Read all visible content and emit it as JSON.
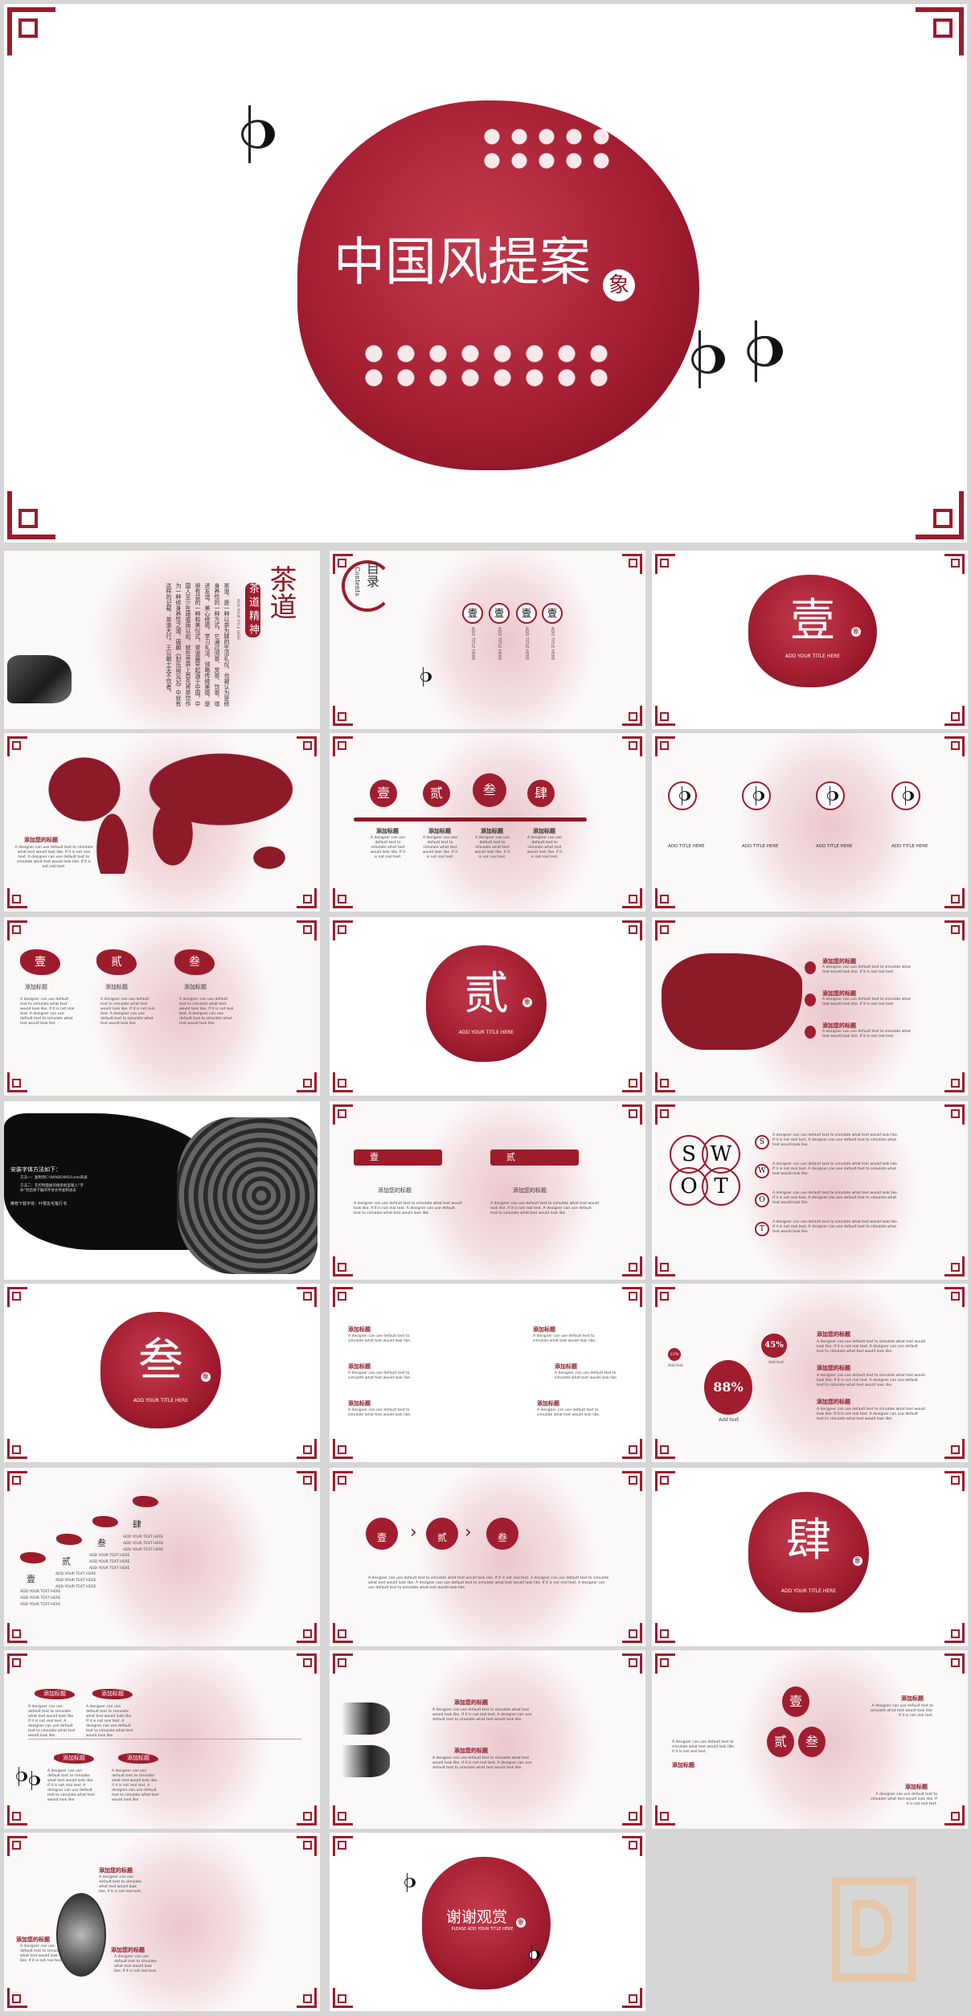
{
  "cover": {
    "title": "中国风提案",
    "seal": "象"
  },
  "slides": {
    "s1": {
      "title": "茶道",
      "subtitle": "茶道精神",
      "en": "ADD YOUR TITLE HERE",
      "body": "茶道，是一种以茶为媒的生活礼仪，也被认为是修身养性的一种方式，它通过沏茶、赏茶、饮茶，增进友谊，美心修德，学习礼法，领略传统美德，是很有益的一种和美仪式。茶道最早起源于中国。中国人至少在唐或唐以前，就在世界上首先将茶饮作为一种修身养性之道，唐朝《封氏闻见记》中就有这样的记载：茶道大行，王公朝士无不饮者。"
    },
    "s2": {
      "title": "目录",
      "en": "Contents",
      "num": "壹",
      "item": "ADD TITLE HERE"
    },
    "s3": {
      "char": "壹",
      "sub": "ADD YOUR TITLE HERE",
      "seal": "象"
    },
    "s4": {
      "heading": "添加您的标题",
      "body": "A designer can use default text to simulate what text would look like. If it is not real text. A designer can use default text to simulate what text would look like. If it is not real text."
    },
    "s5": {
      "nums": [
        "壹",
        "贰",
        "叁",
        "肆"
      ],
      "heading": "添加标题",
      "body": "A designer can use default text to simulate what text would look like. If it is not real text."
    },
    "s6": {
      "label": "ADD TITLE HERE"
    },
    "s7": {
      "nums": [
        "壹",
        "贰",
        "叁"
      ],
      "heading": "添加标题",
      "body": "A designer can use default text to simulate what text would look like. If it is not real text. A designer can use default text to simulate what text would look like"
    },
    "s8": {
      "char": "贰",
      "sub": "ADD YOUR TITLE HERE",
      "seal": "象"
    },
    "s9": {
      "heading": "添加您的标题",
      "body": "A designer can use default text to simulate what text would look like. If it is not real text."
    },
    "s10": {
      "title": "安装字体方法如下：",
      "m1": "方法一：复制到C:\\WINDOWS\\Fonts目录",
      "m2": "方法二：在控制面板的搜索框里输入“字体”然后将下载的字体文件复制进去",
      "rec": "推荐下载字体：叶根友毛笔行书"
    },
    "s11": {
      "nums": [
        "壹",
        "贰"
      ],
      "heading": "添加您的标题",
      "body": "A designer can use default text to simulate what text would look like. If it is not real text. A designer can use default text to simulate what text would look like"
    },
    "s12": {
      "letters": [
        "S",
        "W",
        "O",
        "T"
      ],
      "body": "A designer can use default text to simulate what text would look like. If it is not real text. A designer can use default text to simulate what text would look like"
    },
    "s13": {
      "char": "叁",
      "sub": "ADD YOUR TITLE HERE",
      "seal": "象"
    },
    "s14": {
      "heading": "添加标题",
      "body": "A designer can use default text to simulate what text would look like."
    },
    "s15": {
      "p1": "12%",
      "p2": "45%",
      "p3": "88%",
      "add": "Add text",
      "heading": "添加您的标题",
      "body": "A designer can use default text to simulate what text would look like. If it is not real text. A designer can use default text to simulate what text would look like."
    },
    "s16": {
      "nums": [
        "壹",
        "贰",
        "叁",
        "肆"
      ],
      "item": "ADD YOUR TEXT HERE"
    },
    "s17": {
      "nums": [
        "壹",
        "贰",
        "叁"
      ],
      "body": "A designer can use default text to simulate what text would look like. If it is not real text. A designer can use default text to simulate what text would look like. A designer can use default text to simulate what text would look like. If it is not real text. A designer can use default text to simulate what text would look like."
    },
    "s18": {
      "char": "肆",
      "sub": "ADD YOUR TITLE HERE",
      "seal": "象"
    },
    "s19": {
      "heading": "添加标题",
      "body": "A designer can use default text to simulate what text would look like. If it is not real text. A designer can use default text to simulate what text would look like"
    },
    "s20": {
      "heading": "添加您的标题",
      "body": "A designer can use default text to simulate what text would look like. If it is not real text. A designer can use default text to simulate what text would look like."
    },
    "s21": {
      "nums": [
        "壹",
        "贰",
        "叁"
      ],
      "heading": "添加标题",
      "body": "A designer can use default text to simulate what text would look like. If it is not real text."
    },
    "s22": {
      "heading": "添加您的标题",
      "body": "A designer can use default text to simulate what text would look like. If it is not real text."
    },
    "s23": {
      "title": "谢谢观赏",
      "sub": "PLEASE ADD YOUR TITLE HERE",
      "seal": "象"
    }
  },
  "colors": {
    "accent": "#9d1c2c",
    "background": "#d6d6d6",
    "logo": "#e8c4a0"
  }
}
